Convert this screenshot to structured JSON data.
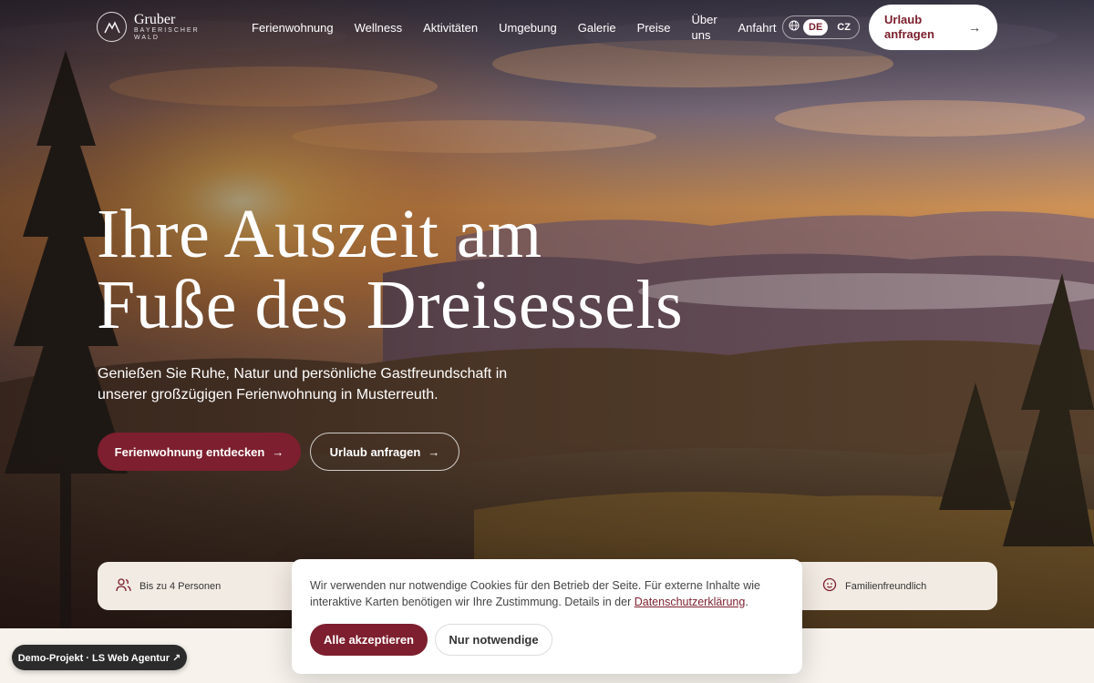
{
  "brand": {
    "title": "Gruber",
    "subtitle_line1": "BAYERISCHER",
    "subtitle_line2": "WALD"
  },
  "nav": {
    "items": [
      {
        "label": "Ferienwohnung"
      },
      {
        "label": "Wellness"
      },
      {
        "label": "Aktivitäten"
      },
      {
        "label": "Umgebung"
      },
      {
        "label": "Galerie"
      },
      {
        "label": "Preise"
      },
      {
        "label": "Über uns"
      },
      {
        "label": "Anfahrt"
      }
    ]
  },
  "language": {
    "options": [
      "DE",
      "CZ"
    ],
    "selected": "DE"
  },
  "header_cta": {
    "line1": "Urlaub",
    "line2": "anfragen"
  },
  "hero": {
    "title_line1": "Ihre Auszeit am",
    "title_line2": "Fuße des Dreisessels",
    "subtitle": "Genießen Sie Ruhe, Natur und persönliche Gastfreundschaft in unserer großzügigen Ferienwohnung in Musterreuth.",
    "primary_button": "Ferienwohnung entdecken",
    "secondary_button": "Urlaub anfragen"
  },
  "features": {
    "left": "Bis zu 4 Personen",
    "right": "Familienfreundlich"
  },
  "cookie": {
    "text_before_link": "Wir verwenden nur notwendige Cookies für den Betrieb der Seite. Für externe Inhalte wie interaktive Karten benötigen wir Ihre Zustimmung. Details in der ",
    "link": "Datenschutzerklärung",
    "text_after_link": ".",
    "accept_button": "Alle akzeptieren",
    "necessary_button": "Nur notwendige"
  },
  "demo_badge": "Demo-Projekt · LS Web Agentur ↗",
  "colors": {
    "accent": "#7d1f2e",
    "feature_bar": "#f2ebe3",
    "badge": "#2b2b2b"
  }
}
